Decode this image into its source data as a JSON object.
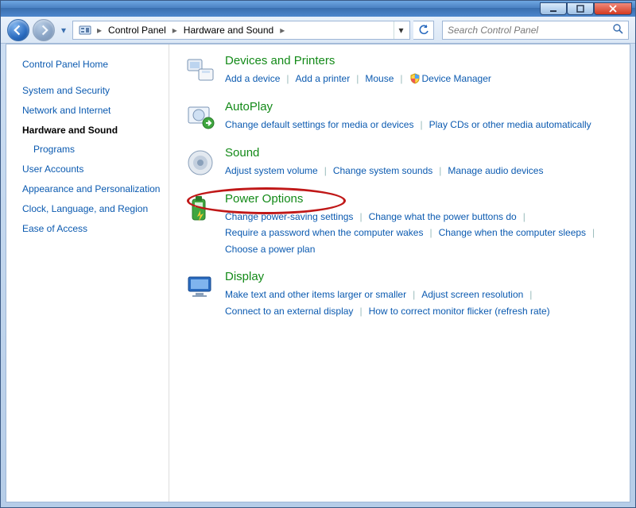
{
  "window_controls": {
    "minimize": "minimize",
    "maximize": "maximize",
    "close": "close"
  },
  "breadcrumb": {
    "segments": [
      "Control Panel",
      "Hardware and Sound"
    ]
  },
  "search": {
    "placeholder": "Search Control Panel"
  },
  "sidebar": {
    "home": "Control Panel Home",
    "items": [
      {
        "label": "System and Security",
        "active": false,
        "indent": false
      },
      {
        "label": "Network and Internet",
        "active": false,
        "indent": false
      },
      {
        "label": "Hardware and Sound",
        "active": true,
        "indent": false
      },
      {
        "label": "Programs",
        "active": false,
        "indent": true
      },
      {
        "label": "User Accounts",
        "active": false,
        "indent": false
      },
      {
        "label": "Appearance and Personalization",
        "active": false,
        "indent": false
      },
      {
        "label": "Clock, Language, and Region",
        "active": false,
        "indent": false
      },
      {
        "label": "Ease of Access",
        "active": false,
        "indent": false
      }
    ]
  },
  "categories": [
    {
      "icon": "devices-printers",
      "title": "Devices and Printers",
      "links": [
        "Add a device",
        "Add a printer",
        "Mouse",
        "Device Manager"
      ],
      "shield_indices": [
        3
      ]
    },
    {
      "icon": "autoplay",
      "title": "AutoPlay",
      "links": [
        "Change default settings for media or devices",
        "Play CDs or other media automatically"
      ],
      "shield_indices": []
    },
    {
      "icon": "sound",
      "title": "Sound",
      "links": [
        "Adjust system volume",
        "Change system sounds",
        "Manage audio devices"
      ],
      "shield_indices": []
    },
    {
      "icon": "power",
      "title": "Power Options",
      "links": [
        "Change power-saving settings",
        "Change what the power buttons do",
        "Require a password when the computer wakes",
        "Change when the computer sleeps",
        "Choose a power plan"
      ],
      "shield_indices": [],
      "highlighted": true
    },
    {
      "icon": "display",
      "title": "Display",
      "links": [
        "Make text and other items larger or smaller",
        "Adjust screen resolution",
        "Connect to an external display",
        "How to correct monitor flicker (refresh rate)"
      ],
      "shield_indices": []
    }
  ]
}
